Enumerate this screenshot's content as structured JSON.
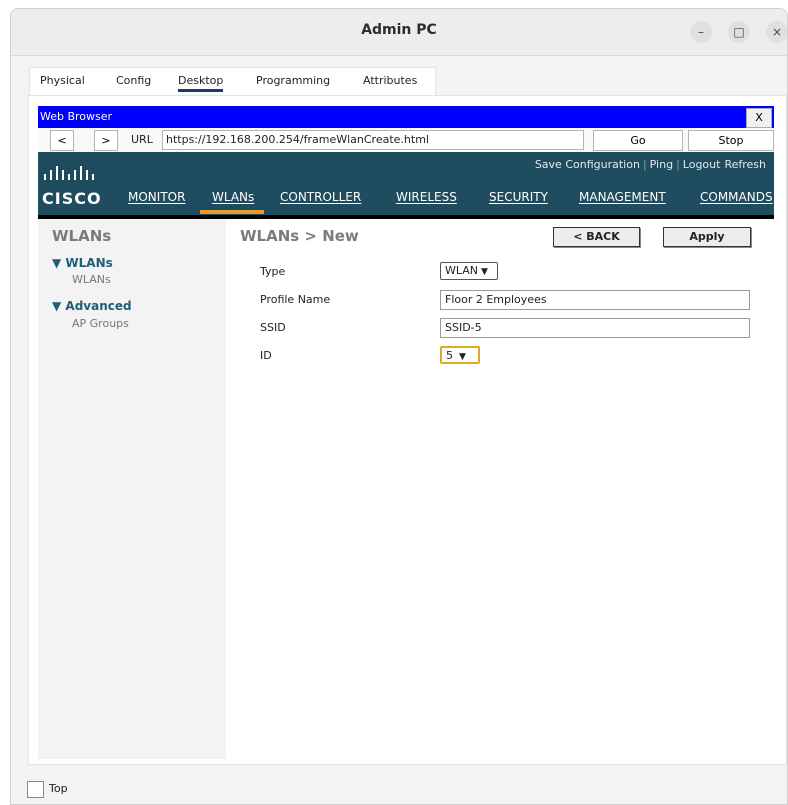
{
  "window": {
    "title": "Admin PC",
    "minimize": "–",
    "maximize": "□",
    "close": "×"
  },
  "tabs": [
    "Physical",
    "Config",
    "Desktop",
    "Programming",
    "Attributes"
  ],
  "active_tab": "Desktop",
  "browser": {
    "title": "Web Browser",
    "close_label": "X",
    "back": "<",
    "forward": ">",
    "url_label": "URL",
    "url": "https://192.168.200.254/frameWlanCreate.html",
    "go": "Go",
    "stop": "Stop"
  },
  "cisco": {
    "logo": "CISCO",
    "top_links": [
      "Save Configuration",
      "Ping",
      "Logout",
      "Refresh"
    ],
    "menu": [
      "MONITOR",
      "WLANs",
      "CONTROLLER",
      "WIRELESS",
      "SECURITY",
      "MANAGEMENT",
      "COMMANDS"
    ],
    "active_menu": "WLANs"
  },
  "sidebar": {
    "title": "WLANs",
    "groups": [
      {
        "label": "WLANs",
        "items": [
          "WLANs"
        ]
      },
      {
        "label": "Advanced",
        "items": [
          "AP Groups"
        ]
      }
    ]
  },
  "main": {
    "title": "WLANs > New",
    "back_button": "< BACK",
    "apply_button": "Apply",
    "fields": {
      "type_label": "Type",
      "type_value": "WLAN",
      "profile_label": "Profile Name",
      "profile_value": "Floor 2 Employees",
      "ssid_label": "SSID",
      "ssid_value": "SSID-5",
      "id_label": "ID",
      "id_value": "5"
    }
  },
  "bottom": {
    "top_label": "Top"
  },
  "colors": {
    "browser_bar": "#0000ff",
    "cisco_bar": "#1f4d5f",
    "accent": "#e99b33",
    "sidebar_link": "#1f5d78"
  }
}
